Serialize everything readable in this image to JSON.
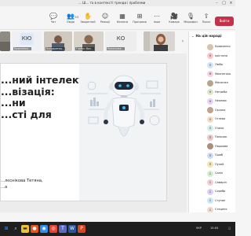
{
  "window": {
    "title": "... Ш... та в контексті тренди і проблеми",
    "controls": [
      "–",
      "□",
      "×"
    ]
  },
  "toolbar": {
    "tools": [
      {
        "label": "Чат",
        "icon": "chat-icon",
        "glyph": "💬"
      },
      {
        "label": "Люди",
        "icon": "people-icon",
        "glyph": "👥",
        "badge": "53"
      },
      {
        "label": "Зворотний",
        "icon": "raise-hand-icon",
        "glyph": "✋"
      },
      {
        "label": "Реакції",
        "icon": "reactions-icon",
        "glyph": "☺"
      },
      {
        "label": "Кімнати",
        "icon": "rooms-icon",
        "glyph": "▦"
      },
      {
        "label": "Програми",
        "icon": "apps-icon",
        "glyph": "⊞"
      },
      {
        "label": "Інше",
        "icon": "more-icon",
        "glyph": "⋯"
      },
      {
        "label": "Камера",
        "icon": "camera-icon",
        "glyph": "🎥"
      },
      {
        "label": "Мікрофон",
        "icon": "mic-icon",
        "glyph": "🎙"
      },
      {
        "label": "Показ",
        "icon": "share-icon",
        "glyph": "⇧"
      }
    ],
    "leave_label": "Вийти"
  },
  "video_strip": [
    {
      "initials": "",
      "name": "",
      "video": true
    },
    {
      "initials": "КЮ",
      "name": "Кравченко...",
      "video": false
    },
    {
      "initials": "",
      "name": "Бондаренко...",
      "video": true
    },
    {
      "initials": "",
      "name": "Горбач Вол...",
      "video": true
    },
    {
      "initials": "КО",
      "name": "Ковальова...",
      "video": false
    }
  ],
  "slide": {
    "title": "...ний інтелект\n...візація:\n...ни\n...сті для",
    "author": "...лєснікова Тетяна,\n...а"
  },
  "panel": {
    "header": "На цій нараді",
    "participants": [
      {
        "initials": "",
        "name": "Кравченко",
        "color": "#d9c3b0"
      },
      {
        "initials": "К",
        "name": "крістина",
        "color": "#f6c9cf"
      },
      {
        "initials": "Л",
        "name": "Люба",
        "color": "#cfe4f7"
      },
      {
        "initials": "М",
        "name": "Мохнатько",
        "color": "#f3d5e7"
      },
      {
        "initials": "",
        "name": "Мосонжн",
        "color": "#b7a48d"
      },
      {
        "initials": "Н",
        "name": "Нетреба",
        "color": "#dfe7c9"
      },
      {
        "initials": "Н",
        "name": "Нежмах",
        "color": "#e5d4f4"
      },
      {
        "initials": "",
        "name": "Оксана",
        "color": "#c2a28c"
      },
      {
        "initials": "О",
        "name": "Оглєва",
        "color": "#f7dcc4"
      },
      {
        "initials": "О",
        "name": "Очеха",
        "color": "#d3eee7"
      },
      {
        "initials": "П",
        "name": "Пальчик",
        "color": "#e8c9c9"
      },
      {
        "initials": "",
        "name": "Пашкова",
        "color": "#a98f7a"
      },
      {
        "initials": "П",
        "name": "Пшеб",
        "color": "#cfdcf5"
      },
      {
        "initials": "П",
        "name": "Пулей",
        "color": "#f4e2b8"
      },
      {
        "initials": "С",
        "name": "Санін",
        "color": "#d6ecd1"
      },
      {
        "initials": "С",
        "name": "Самарін",
        "color": "#f1cfd8"
      },
      {
        "initials": "С",
        "name": "Серебр",
        "color": "#dcd2f3"
      },
      {
        "initials": "С",
        "name": "Ступан",
        "color": "#cce6f2"
      },
      {
        "initials": "С",
        "name": "Стеценк",
        "color": "#f2d9c9"
      }
    ]
  },
  "taskbar": {
    "tray_lang": "УКР",
    "tray_time": "15:05"
  }
}
